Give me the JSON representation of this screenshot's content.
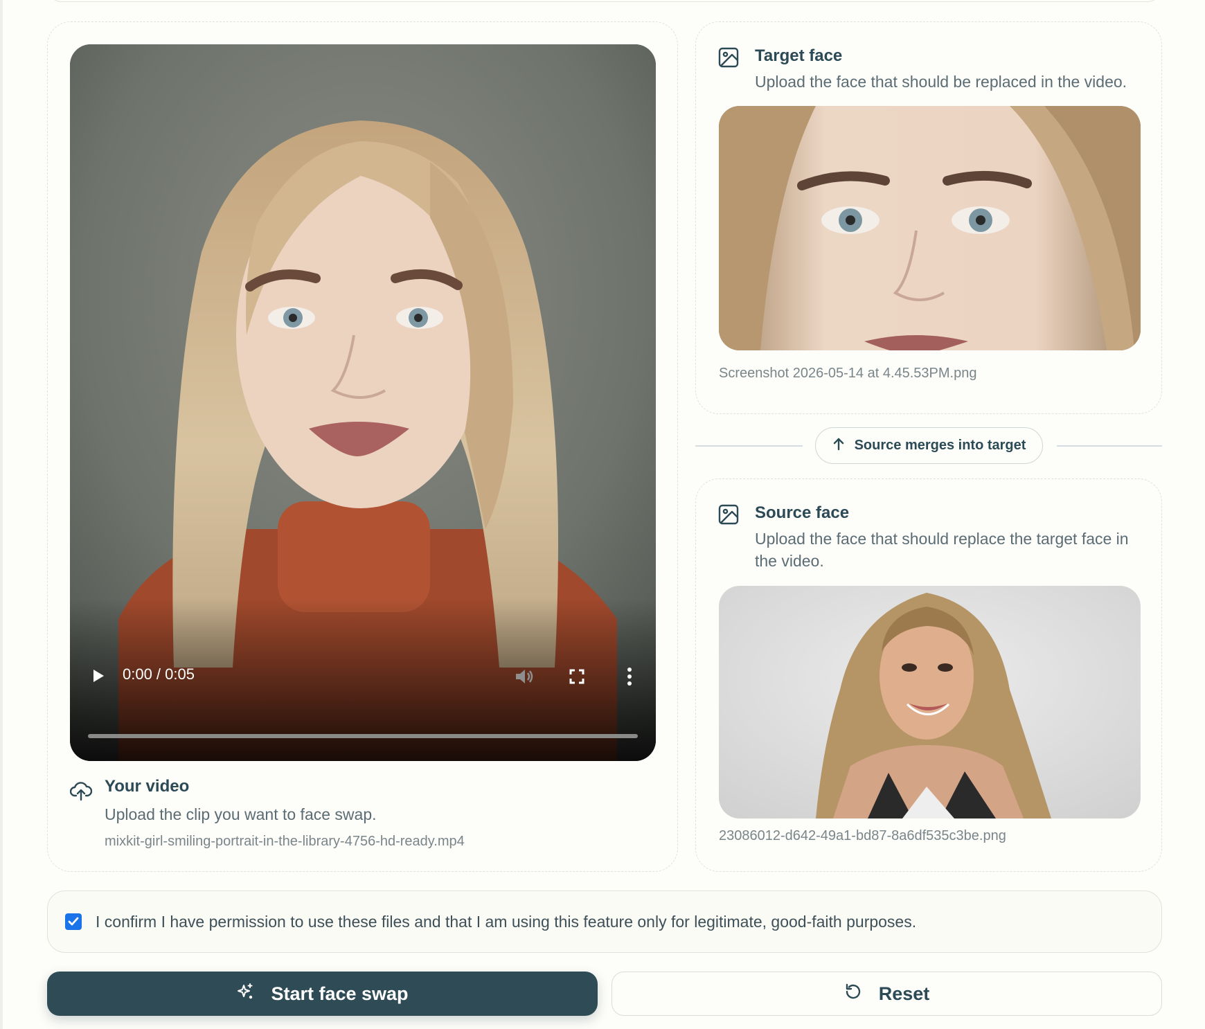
{
  "video_card": {
    "title": "Your video",
    "description": "Upload the clip you want to face swap.",
    "file_name": "mixkit-girl-smiling-portrait-in-the-library-4756-hd-ready.mp4",
    "player": {
      "time": "0:00 / 0:05",
      "progress": 0.0
    },
    "icon": "upload-cloud-icon"
  },
  "target_card": {
    "title": "Target face",
    "description": "Upload the face that should be replaced in the video.",
    "file_name": "Screenshot 2026-05-14 at 4.45.53PM.png",
    "icon": "image-icon"
  },
  "divider": {
    "label": "Source merges into target",
    "icon": "arrow-up-icon"
  },
  "source_card": {
    "title": "Source face",
    "description": "Upload the face that should replace the target face in the video.",
    "file_name": "23086012-d642-49a1-bd87-8a6df535c3be.png",
    "icon": "image-icon"
  },
  "consent": {
    "checked": true,
    "text": "I confirm I have permission to use these files and that I am using this feature only for legitimate, good-faith purposes."
  },
  "actions": {
    "start_label": "Start face swap",
    "reset_label": "Reset"
  },
  "colors": {
    "primary": "#2f4b55",
    "background": "#fdfdf9",
    "checkbox": "#1a73e8"
  }
}
